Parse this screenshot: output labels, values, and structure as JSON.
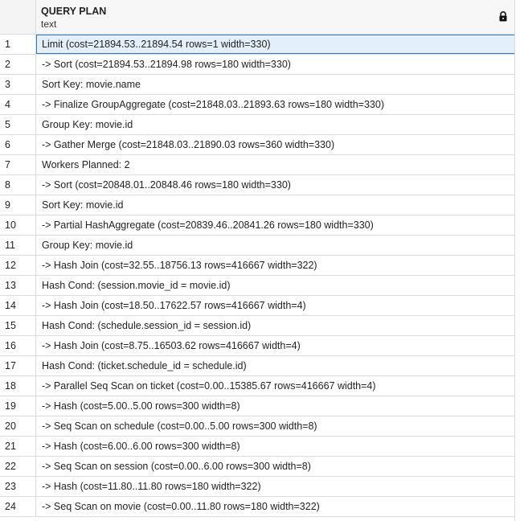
{
  "header": {
    "column_title": "QUERY PLAN",
    "column_type": "text",
    "lock_icon": "lock-icon"
  },
  "rows": [
    {
      "num": "1",
      "text": "Limit (cost=21894.53..21894.54 rows=1 width=330)"
    },
    {
      "num": "2",
      "text": "-> Sort (cost=21894.53..21894.98 rows=180 width=330)"
    },
    {
      "num": "3",
      "text": "Sort Key: movie.name"
    },
    {
      "num": "4",
      "text": "-> Finalize GroupAggregate (cost=21848.03..21893.63 rows=180 width=330)"
    },
    {
      "num": "5",
      "text": "Group Key: movie.id"
    },
    {
      "num": "6",
      "text": "-> Gather Merge (cost=21848.03..21890.03 rows=360 width=330)"
    },
    {
      "num": "7",
      "text": "Workers Planned: 2"
    },
    {
      "num": "8",
      "text": "-> Sort (cost=20848.01..20848.46 rows=180 width=330)"
    },
    {
      "num": "9",
      "text": "Sort Key: movie.id"
    },
    {
      "num": "10",
      "text": "-> Partial HashAggregate (cost=20839.46..20841.26 rows=180 width=330)"
    },
    {
      "num": "11",
      "text": "Group Key: movie.id"
    },
    {
      "num": "12",
      "text": "-> Hash Join (cost=32.55..18756.13 rows=416667 width=322)"
    },
    {
      "num": "13",
      "text": "Hash Cond: (session.movie_id = movie.id)"
    },
    {
      "num": "14",
      "text": "-> Hash Join (cost=18.50..17622.57 rows=416667 width=4)"
    },
    {
      "num": "15",
      "text": "Hash Cond: (schedule.session_id = session.id)"
    },
    {
      "num": "16",
      "text": "-> Hash Join (cost=8.75..16503.62 rows=416667 width=4)"
    },
    {
      "num": "17",
      "text": "Hash Cond: (ticket.schedule_id = schedule.id)"
    },
    {
      "num": "18",
      "text": "-> Parallel Seq Scan on ticket (cost=0.00..15385.67 rows=416667 width=4)"
    },
    {
      "num": "19",
      "text": "-> Hash (cost=5.00..5.00 rows=300 width=8)"
    },
    {
      "num": "20",
      "text": "-> Seq Scan on schedule (cost=0.00..5.00 rows=300 width=8)"
    },
    {
      "num": "21",
      "text": "-> Hash (cost=6.00..6.00 rows=300 width=8)"
    },
    {
      "num": "22",
      "text": "-> Seq Scan on session (cost=0.00..6.00 rows=300 width=8)"
    },
    {
      "num": "23",
      "text": "-> Hash (cost=11.80..11.80 rows=180 width=322)"
    },
    {
      "num": "24",
      "text": "-> Seq Scan on movie (cost=0.00..11.80 rows=180 width=322)"
    }
  ]
}
